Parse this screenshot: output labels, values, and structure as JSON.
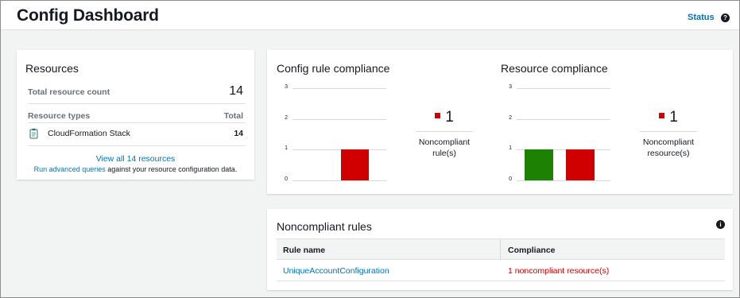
{
  "header": {
    "title": "Config Dashboard",
    "status_label": "Status",
    "help_icon": "?"
  },
  "resources": {
    "title": "Resources",
    "total_label": "Total resource count",
    "total_value": "14",
    "types_label": "Resource types",
    "types_total_label": "Total",
    "rows": [
      {
        "icon": "cloudformation-stack-icon",
        "name": "CloudFormation Stack",
        "count": "14"
      }
    ],
    "view_all": "View all 14 resources",
    "advanced_link": "Run advanced queries",
    "advanced_suffix": " against your resource configuration data."
  },
  "config_rule_compliance": {
    "title": "Config rule compliance",
    "summary_value": "1",
    "summary_label_line1": "Noncompliant",
    "summary_label_line2": "rule(s)"
  },
  "resource_compliance": {
    "title": "Resource compliance",
    "summary_value": "1",
    "summary_label_line1": "Noncompliant",
    "summary_label_line2": "resource(s)"
  },
  "chart_data": [
    {
      "type": "bar",
      "title": "Config rule compliance",
      "ylim": [
        0,
        3
      ],
      "yticks": [
        "0",
        "1",
        "2",
        "3"
      ],
      "grid": true,
      "series": [
        {
          "values": [
            1
          ],
          "color": "#d00000"
        }
      ]
    },
    {
      "type": "bar",
      "title": "Resource compliance",
      "ylim": [
        0,
        3
      ],
      "yticks": [
        "0",
        "1",
        "2",
        "3"
      ],
      "grid": true,
      "series": [
        {
          "values": [
            1
          ],
          "color": "#1d8102"
        },
        {
          "values": [
            1
          ],
          "color": "#d00000"
        }
      ]
    }
  ],
  "noncompliant_rules": {
    "title": "Noncompliant rules",
    "info_icon": "i",
    "columns": [
      "Rule name",
      "Compliance"
    ],
    "rows": [
      {
        "rule": "UniqueAccountConfiguration",
        "compliance": "1 noncompliant resource(s)"
      }
    ]
  }
}
